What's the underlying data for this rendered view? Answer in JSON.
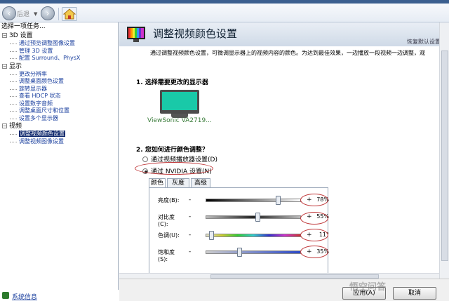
{
  "toolbar": {
    "back_label": "后退",
    "back_icon": "back-arrow-icon",
    "forward_icon": "forward-arrow-icon",
    "home_icon": "control-panel-home-icon"
  },
  "sidebar": {
    "header": "选择一项任务...",
    "groups": [
      {
        "label": "3D 设置",
        "items": [
          {
            "label": "通过预览调整图像设置"
          },
          {
            "label": "管理 3D 设置"
          },
          {
            "label": "配置 Surround、PhysX"
          }
        ]
      },
      {
        "label": "显示",
        "items": [
          {
            "label": "更改分辨率"
          },
          {
            "label": "调整桌面颜色设置"
          },
          {
            "label": "旋转显示器"
          },
          {
            "label": "查看 HDCP 状态"
          },
          {
            "label": "设置数字音频"
          },
          {
            "label": "调整桌面尺寸和位置"
          },
          {
            "label": "设置多个显示器"
          }
        ]
      },
      {
        "label": "视频",
        "items": [
          {
            "label": "调整视频颜色设置",
            "selected": true
          },
          {
            "label": "调整视频图像设置"
          }
        ]
      }
    ],
    "system_info": "系统信息"
  },
  "main": {
    "title": "调整视频颜色设置",
    "restore_defaults": "恢复默认设置",
    "description": "通过调整视频颜色设置，可微调显示器上的视频内容的颜色。为达到最佳效果，一边播放一段视频一边调整，观",
    "section1_title": "1. 选择需要更改的显示器",
    "monitor_label": "ViewSonic VA2719...",
    "section2_title": "2. 您如何进行颜色调整？",
    "radio_player": "通过视频播放器设置(D)",
    "radio_nvidia": "通过 NVIDIA 设置(N)",
    "tabs": [
      "颜色",
      "灰度",
      "高级"
    ],
    "sliders": [
      {
        "label": "亮度(B):",
        "value_text": "78%",
        "value": 0.78
      },
      {
        "label": "对比度",
        "label2": "(C):",
        "value_text": "55%",
        "value": 0.55
      },
      {
        "label": "色调(U):",
        "value_text": "11°",
        "value": 0.03
      },
      {
        "label": "饱和度",
        "label2": "(S):",
        "value_text": "35%",
        "value": 0.35
      }
    ]
  },
  "footer": {
    "apply": "应用(A)",
    "cancel": "取消"
  },
  "watermark": "悟空问答",
  "colors": {
    "accent_circle": "#c0393b",
    "link_blue": "#1a3f9e",
    "selected_bg": "#0a246a"
  }
}
